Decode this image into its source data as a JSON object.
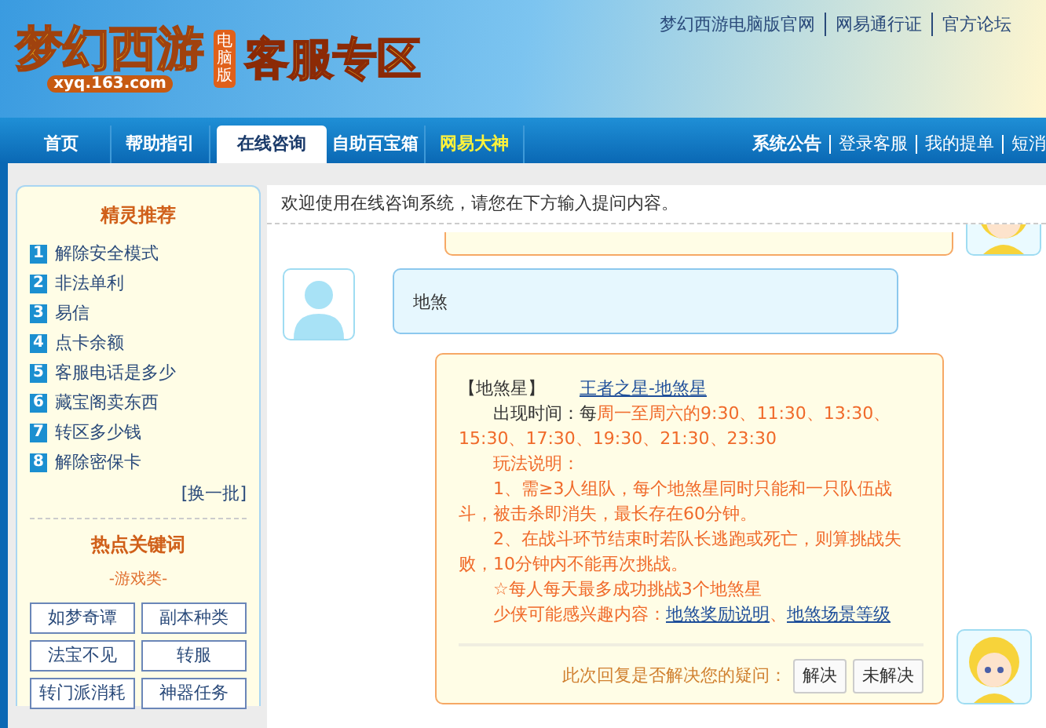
{
  "header": {
    "logo_text": "梦幻西游",
    "logo_badge": "电脑版",
    "logo_domain": "xyq.163.com",
    "section_title": "客服专区",
    "links": [
      "梦幻西游电脑版官网",
      "网易通行证",
      "官方论坛"
    ]
  },
  "nav": {
    "tabs": [
      {
        "label": "首页",
        "selected": false,
        "highlight": false
      },
      {
        "label": "帮助指引",
        "selected": false,
        "highlight": false
      },
      {
        "label": "在线咨询",
        "selected": true,
        "highlight": false
      },
      {
        "label": "自助百宝箱",
        "selected": false,
        "highlight": false
      },
      {
        "label": "网易大神",
        "selected": false,
        "highlight": true
      }
    ],
    "right_links": [
      "系统公告",
      "登录客服",
      "我的提单",
      "短消"
    ]
  },
  "sidebar": {
    "recommend_title": "精灵推荐",
    "recommend": [
      {
        "number": "1",
        "label": "解除安全模式"
      },
      {
        "number": "2",
        "label": "非法单利"
      },
      {
        "number": "3",
        "label": "易信"
      },
      {
        "number": "4",
        "label": "点卡余额"
      },
      {
        "number": "5",
        "label": "客服电话是多少"
      },
      {
        "number": "6",
        "label": "藏宝阁卖东西"
      },
      {
        "number": "7",
        "label": "转区多少钱"
      },
      {
        "number": "8",
        "label": "解除密保卡"
      }
    ],
    "refresh": "[换一批]",
    "keywords_title": "热点关键词",
    "keywords_category": "-游戏类-",
    "keywords": [
      "如梦奇谭",
      "副本种类",
      "法宝不见",
      "转服",
      "转门派消耗",
      "神器任务"
    ]
  },
  "chat": {
    "welcome": "欢迎使用在线咨询系统，请您在下方输入提问内容。",
    "messages": [
      {
        "kind": "user",
        "text": "地煞"
      },
      {
        "kind": "bot",
        "paragraphs": [
          [
            {
              "kind": "plain",
              "text": "【地煞星】"
            },
            {
              "kind": "gap"
            },
            {
              "kind": "link",
              "text": "王者之星-地煞星"
            }
          ],
          [
            {
              "kind": "indent"
            },
            {
              "kind": "plain",
              "text": "出现时间：每"
            },
            {
              "kind": "highlight",
              "text": "周一至周六的9:30、11:30、13:30、15:30、17:30、19:30、21:30、23:30"
            }
          ],
          [
            {
              "kind": "indent"
            },
            {
              "kind": "highlight",
              "text": "玩法说明："
            }
          ],
          [
            {
              "kind": "indent"
            },
            {
              "kind": "highlight",
              "text": "1、需≥3人组队，每个地煞星同时只能和一只队伍战斗，被击杀即消失，最长存在60分钟。"
            }
          ],
          [
            {
              "kind": "indent"
            },
            {
              "kind": "highlight",
              "text": "2、在战斗环节结束时若队长逃跑或死亡，则算挑战失败，10分钟内不能再次挑战。"
            }
          ],
          [
            {
              "kind": "indent"
            },
            {
              "kind": "highlight",
              "text": "☆每人每天最多成功挑战3个地煞星"
            }
          ],
          [
            {
              "kind": "indent"
            },
            {
              "kind": "highlight",
              "text": "少侠可能感兴趣内容："
            },
            {
              "kind": "link",
              "text": "地煞奖励说明"
            },
            {
              "kind": "highlight",
              "text": "、"
            },
            {
              "kind": "link",
              "text": "地煞场景等级"
            }
          ]
        ],
        "feedback": {
          "question": "此次回复是否解决您的疑问：",
          "buttons": [
            "解决",
            "未解决"
          ]
        }
      }
    ]
  }
}
